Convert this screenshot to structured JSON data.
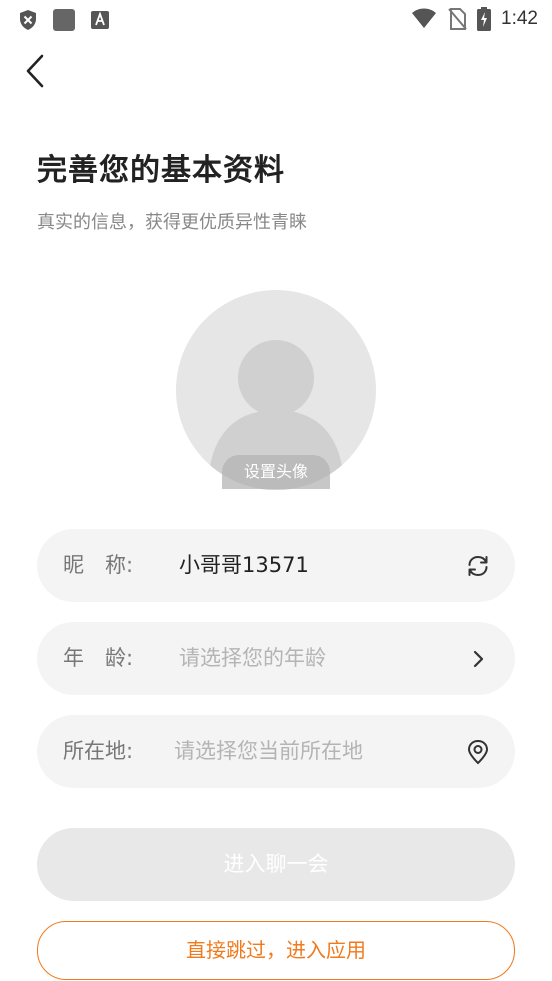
{
  "status_bar": {
    "time": "1:42",
    "left_icons": [
      "shield-icon",
      "app-icon",
      "font-icon"
    ],
    "right_icons": [
      "wifi-icon",
      "no-sim-icon",
      "battery-charging-icon"
    ]
  },
  "header": {
    "back_icon": "chevron-left-icon",
    "title": "完善您的基本资料",
    "subtitle": "真实的信息，获得更优质异性青睐"
  },
  "avatar": {
    "label": "设置头像"
  },
  "form": {
    "nickname": {
      "label": "昵　称:",
      "value": "小哥哥13571",
      "icon": "refresh-icon"
    },
    "age": {
      "label": "年　龄:",
      "placeholder": "请选择您的年龄",
      "icon": "chevron-right-icon"
    },
    "location": {
      "label": "所在地:",
      "placeholder": "请选择您当前所在地",
      "icon": "location-pin-icon"
    }
  },
  "buttons": {
    "enter_chat": "进入聊一会",
    "skip": "直接跳过，进入应用"
  },
  "colors": {
    "accent": "#f07a1e",
    "field_bg": "#f4f4f4",
    "disabled_button": "#e8e8e8"
  }
}
